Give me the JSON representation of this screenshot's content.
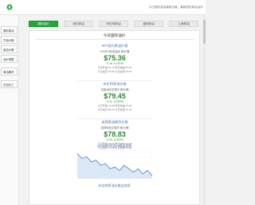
{
  "header": {
    "notice": "今日国际原油最新价格，最新国际原油油价"
  },
  "sidebar": {
    "items": [
      {
        "label": "国际原油"
      },
      {
        "label": "汽油价格"
      },
      {
        "label": "柴油价格"
      },
      {
        "label": "油价调整"
      },
      {
        "label": "原油期货"
      },
      {
        "label": "石油化工"
      }
    ]
  },
  "tabs": [
    {
      "label": "国际油价",
      "active": true
    },
    {
      "label": "纽约原油",
      "active": false
    },
    {
      "label": "布伦特原油",
      "active": false
    },
    {
      "label": "迪拜原油",
      "active": false
    },
    {
      "label": "上海原油",
      "active": false
    }
  ],
  "panel": {
    "title": "今日国际油价"
  },
  "cards": [
    {
      "name": "WTI纽约原油价格",
      "sub": "NYMEX原油连续 美元/桶",
      "price": "$75.36",
      "change": "-0.16 -0.201%",
      "stat1": "今日开盘:75.47  昨日收盘:75.52",
      "stat2": "今日最高:75.89  今日最低:75.10"
    },
    {
      "name": "布伦特原油价格",
      "sub": "伦敦洲际交易所 美元/桶",
      "price": "$79.45",
      "change": "-0.41 -0.520%",
      "stat1": "今日开盘:79.85  昨日收盘:79.87",
      "stat2": "今日最高:80.05  今日最低:79.18"
    },
    {
      "name": "迪拜原油期货价格",
      "sub": "迪拜商品交易所 美元/桶",
      "price": "$78.83",
      "change": "-0.25 -0.320%",
      "stat1": "今日开盘:78.95  昨日收盘:79.08",
      "stat2": "今日最高:79.40  今日最低:78.60"
    }
  ],
  "charts": [
    {
      "title": "WTI纽约原油价格走势图"
    },
    {
      "title": "布伦特原油价格走势图"
    }
  ],
  "chart_data": {
    "type": "line",
    "values": [
      75.9,
      75.6,
      75.7,
      75.4,
      75.5,
      75.2,
      75.3,
      75.0,
      75.1,
      74.9,
      75.2,
      75.0,
      74.8,
      75.0,
      74.7,
      74.9,
      74.6
    ],
    "color": "#4a80c8",
    "fill": "#dce8f6"
  },
  "colors": {
    "accent": "#22a83a",
    "price": "#2e8b3a",
    "link": "#4d78b8"
  }
}
